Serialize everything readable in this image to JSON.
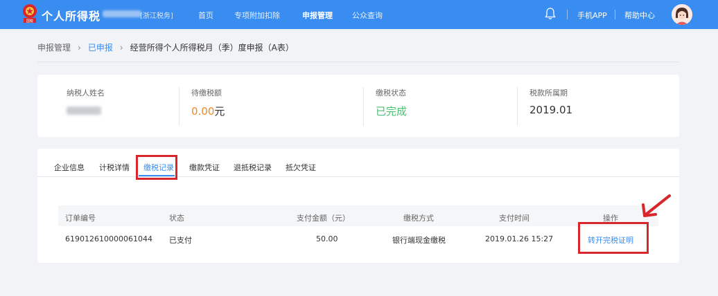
{
  "header": {
    "app_title": "个人所得税",
    "region": "[浙江税务]",
    "nav": [
      "首页",
      "专项附加扣除",
      "申报管理",
      "公众查询"
    ],
    "active_nav": "申报管理",
    "mobile_app": "手机APP",
    "help": "帮助中心",
    "brand_color": "#3a8df0",
    "emblem_text": "国税"
  },
  "breadcrumb": {
    "root": "申报管理",
    "level2": "已申报",
    "current": "经营所得个人所得税月（季）度申报（A表）"
  },
  "summary": {
    "taxpayer_label": "纳税人姓名",
    "due_label": "待缴税额",
    "due_value": "0.00",
    "due_unit": "元",
    "status_label": "缴税状态",
    "status_value": "已完成",
    "period_label": "税款所属期",
    "period_value": "2019.01"
  },
  "tabs": [
    "企业信息",
    "计税详情",
    "缴税记录",
    "缴款凭证",
    "退抵税记录",
    "抵欠凭证"
  ],
  "active_tab": "缴税记录",
  "table": {
    "columns": [
      "订单编号",
      "状态",
      "支付金额（元）",
      "缴税方式",
      "支付时间",
      "操作"
    ],
    "rows": [
      {
        "order_no": "619012610000061044",
        "status": "已支付",
        "amount": "50.00",
        "method": "银行端现金缴税",
        "time": "2019.01.26 15:27",
        "action": "转开完税证明"
      }
    ]
  },
  "colors": {
    "accent": "#3a8df0",
    "amount": "#f08a24",
    "success": "#4bbf70",
    "highlight": "#d8262b"
  }
}
